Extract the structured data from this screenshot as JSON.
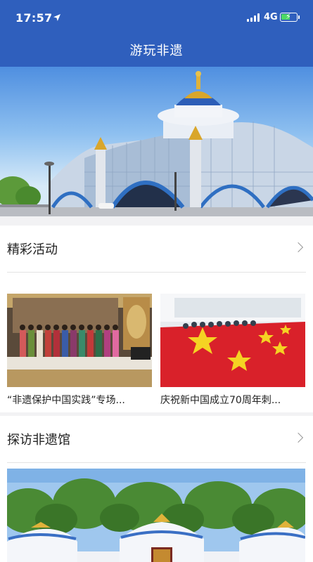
{
  "status_bar": {
    "time": "17:57",
    "network": "4G"
  },
  "nav": {
    "title": "游玩非遗"
  },
  "sections": {
    "activities": {
      "title": "精彩活动",
      "cards": [
        {
          "caption": "“非遗保护中国实践”专场..."
        },
        {
          "caption": "庆祝新中国成立70周年刺..."
        }
      ]
    },
    "museums": {
      "title": "探访非遗馆"
    }
  },
  "colors": {
    "header_bg": "#2f5fbd",
    "battery_fill": "#4cd964",
    "flag_red": "#d9212a",
    "star_yellow": "#f5d323"
  }
}
